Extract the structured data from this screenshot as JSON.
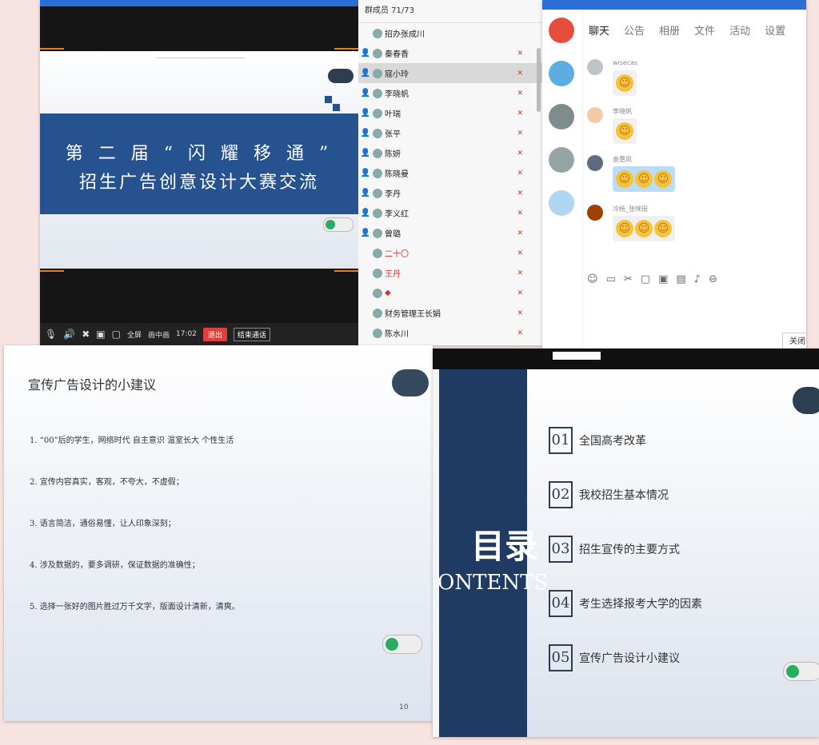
{
  "video_window": {
    "slide_title_line1": "第 二 届 “ 闪 耀 移 通 ”",
    "slide_title_line2": "招生广告创意设计大赛交流",
    "controls": {
      "fullscreen": "全屏",
      "pip": "画中画",
      "time": "17:02",
      "exit": "退出",
      "end_call": "结束通话"
    }
  },
  "member_list": {
    "header": "群成员 71/73",
    "members": [
      {
        "name": "招办张成川",
        "red": false
      },
      {
        "name": "秦春香",
        "red": false
      },
      {
        "name": "寇小玲",
        "red": false
      },
      {
        "name": "李晓帆",
        "red": false
      },
      {
        "name": "叶瑞",
        "red": false
      },
      {
        "name": "张平",
        "red": false
      },
      {
        "name": "陈妍",
        "red": false
      },
      {
        "name": "陈晓曼",
        "red": false
      },
      {
        "name": "李丹",
        "red": false
      },
      {
        "name": "李义红",
        "red": false
      },
      {
        "name": "曾璐",
        "red": false
      },
      {
        "name": "二十〇",
        "red": true
      },
      {
        "name": "王丹",
        "red": true
      },
      {
        "name": "◆",
        "red": true
      },
      {
        "name": "财务管理王长娟",
        "red": false
      },
      {
        "name": "陈水川",
        "red": false
      }
    ]
  },
  "chat_window": {
    "tabs": [
      "聊天",
      "公告",
      "相册",
      "文件",
      "活动",
      "设置"
    ],
    "messages": [
      {
        "name": "wisecas",
        "count": 1,
        "blue": false
      },
      {
        "name": "李晓帆",
        "count": 1,
        "blue": false
      },
      {
        "name": "袁惠凤",
        "count": 3,
        "blue": true
      },
      {
        "name": "冷杨_张咪瑶",
        "count": 3,
        "blue": false
      }
    ],
    "toolbar_icons": [
      "smile-icon",
      "gif-icon",
      "scissors-icon",
      "folder-icon",
      "image-icon",
      "picture-icon",
      "bell-icon",
      "more-icon"
    ],
    "close_button": "关闭"
  },
  "slide_tips": {
    "title": "宣传广告设计的小建议",
    "items": [
      "1. “00”后的学生，网络时代 自主意识 温室长大 个性生活",
      "2. 宣传内容真实，客观，不夸大，不虚假；",
      "3. 语言简洁，通俗易懂，让人印象深刻；",
      "4. 涉及数据的，要多调研，保证数据的准确性；",
      "5. 选择一张好的图片胜过万千文字，版面设计清新，清爽。"
    ],
    "page_number": "10"
  },
  "slide_contents": {
    "heading_cn": "目录",
    "heading_en": "ONTENTS",
    "items": [
      {
        "num": "01",
        "label": "全国高考改革"
      },
      {
        "num": "02",
        "label": "我校招生基本情况"
      },
      {
        "num": "03",
        "label": "招生宣传的主要方式"
      },
      {
        "num": "04",
        "label": "考生选择报考大学的因素"
      },
      {
        "num": "05",
        "label": "宣传广告设计小建议"
      }
    ]
  },
  "colors": {
    "slide_blue": "#26538f",
    "navy": "#1f3a63",
    "exit_red": "#e0403c",
    "accent_blue": "#2a6fd6"
  }
}
